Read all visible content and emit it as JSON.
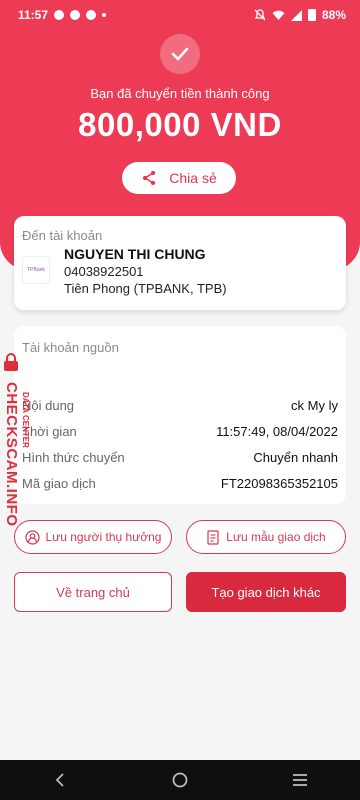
{
  "status_bar": {
    "time": "11:57",
    "battery": "88%"
  },
  "hero": {
    "success_message": "Bạn đã chuyển tiền thành công",
    "amount": "800,000 VND",
    "share_label": "Chia sẻ"
  },
  "recipient": {
    "label": "Đến tài khoản",
    "name": "NGUYEN THI CHUNG",
    "account_number": "04038922501",
    "bank": "Tiên Phong (TPBANK, TPB)"
  },
  "details": {
    "source_label": "Tài khoản nguồn",
    "rows": [
      {
        "key": "Nội dung",
        "value": "ck My ly"
      },
      {
        "key": "Thời gian",
        "value": "11:57:49, 08/04/2022"
      },
      {
        "key": "Hình thức chuyển",
        "value": "Chuyển nhanh"
      },
      {
        "key": "Mã giao dịch",
        "value": "FT22098365352105"
      }
    ]
  },
  "actions": {
    "save_beneficiary": "Lưu người thụ hưởng",
    "save_template": "Lưu mẫu giao dịch",
    "home": "Về trang chủ",
    "new_transaction": "Tạo giao dịch khác"
  },
  "watermark": {
    "text": "CHECKSCAM.INFO",
    "sub": "DATA CENTER"
  },
  "colors": {
    "primary": "#ee3b55",
    "accent": "#d9293e"
  }
}
